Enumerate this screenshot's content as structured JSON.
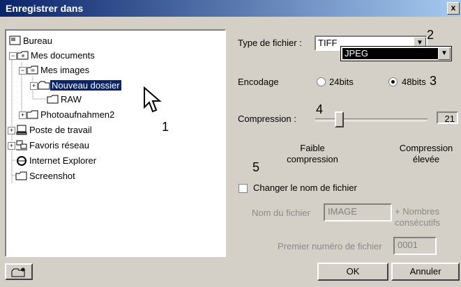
{
  "window": {
    "title": "Enregistrer dans",
    "close_glyph": "x"
  },
  "tree": [
    {
      "label": "Bureau",
      "icon": "desktop-icon",
      "expander": ""
    },
    {
      "label": "Mes documents",
      "icon": "documents-folder-icon",
      "expander": "−"
    },
    {
      "label": "Mes images",
      "icon": "pictures-folder-icon",
      "expander": "−"
    },
    {
      "label": "Nouveau dossier",
      "icon": "folder-icon",
      "expander": "+",
      "selected": true
    },
    {
      "label": "RAW",
      "icon": "folder-icon",
      "expander": ""
    },
    {
      "label": "Photoaufnahmen2",
      "icon": "folder-icon",
      "expander": "+"
    },
    {
      "label": "Poste de travail",
      "icon": "computer-icon",
      "expander": "+"
    },
    {
      "label": "Favoris réseau",
      "icon": "network-icon",
      "expander": "+"
    },
    {
      "label": "Internet Explorer",
      "icon": "ie-icon",
      "expander": ""
    },
    {
      "label": "Screenshot",
      "icon": "folder-icon",
      "expander": ""
    }
  ],
  "file_type": {
    "label": "Type de fichier :",
    "value": "TIFF",
    "dropdown_option": "JPEG"
  },
  "encoding": {
    "label": "Encodage",
    "opt1": "24bits",
    "opt2": "48bits",
    "selected": "48bits"
  },
  "compression": {
    "label": "Compression :",
    "value": "21",
    "low_label": "Faible compression",
    "high_label": "Compression élevée",
    "level_fraction": 0.15
  },
  "rename": {
    "checkbox_label": "Changer le nom de fichier",
    "checked": false,
    "filename_label": "Nom du fichier",
    "filename_value": "IMAGE",
    "suffix_label": "+ Nombres consécutifs",
    "first_number_label": "Premier numéro de fichier",
    "first_number_value": "0001"
  },
  "buttons": {
    "ok": "OK",
    "cancel": "Annuler"
  },
  "annotations": [
    "1",
    "2",
    "3",
    "4",
    "5"
  ]
}
